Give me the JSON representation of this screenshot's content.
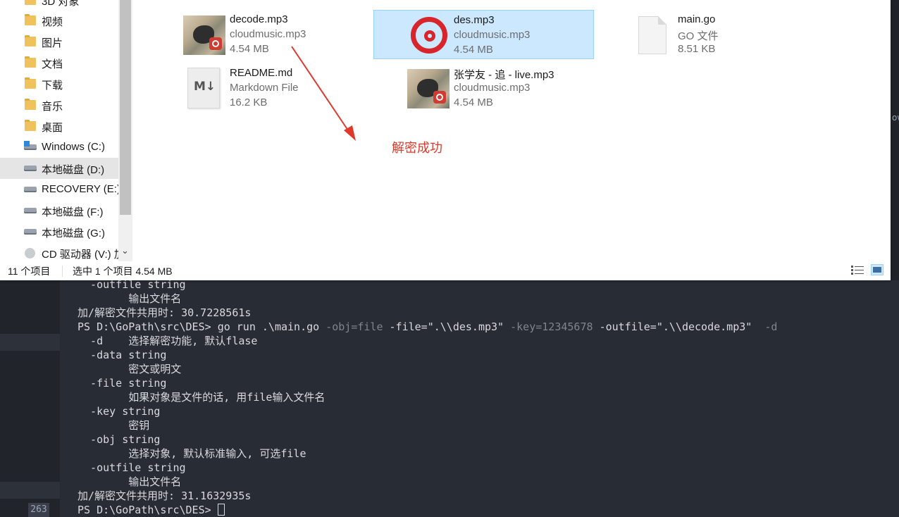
{
  "explorer": {
    "nav": {
      "items": [
        {
          "label": "3D 对象"
        },
        {
          "label": "视频"
        },
        {
          "label": "图片"
        },
        {
          "label": "文档"
        },
        {
          "label": "下载"
        },
        {
          "label": "音乐"
        },
        {
          "label": "桌面"
        },
        {
          "label": "Windows (C:)"
        },
        {
          "label": "本地磁盘 (D:)"
        },
        {
          "label": "RECOVERY (E:)"
        },
        {
          "label": "本地磁盘 (F:)"
        },
        {
          "label": "本地磁盘 (G:)"
        },
        {
          "label": "CD 驱动器 (V:) 加"
        }
      ],
      "selected_index": 8,
      "scroll_chevron": "⌄"
    },
    "files": [
      {
        "name": "decode.mp3",
        "type": "cloudmusic.mp3",
        "size": "4.54 MB",
        "icon": "album-art-icon"
      },
      {
        "name": "des.mp3",
        "type": "cloudmusic.mp3",
        "size": "4.54 MB",
        "icon": "netease-music-icon",
        "selected": true
      },
      {
        "name": "main.go",
        "type": "GO 文件",
        "size": "8.51 KB",
        "icon": "generic-file-icon"
      },
      {
        "name": "README.md",
        "type": "Markdown File",
        "size": "16.2 KB",
        "icon": "markdown-file-icon",
        "icon_text": "M↓"
      },
      {
        "name": "张学友 - 追 - live.mp3",
        "type": "cloudmusic.mp3",
        "size": "4.54 MB",
        "icon": "album-art-icon"
      }
    ],
    "annotation": "解密成功",
    "status": {
      "count": "11 个项目",
      "selected": "选中 1 个项目  4.54 MB"
    },
    "colors": {
      "selection_bg": "#cce8ff",
      "selection_border": "#99d1ff",
      "annotation": "#e0392b"
    }
  },
  "terminal": {
    "line_number": "263",
    "lines": [
      {
        "text": "  -outfile string"
      },
      {
        "text": "        输出文件名"
      },
      {
        "text": "加/解密文件共用时: 30.7228561s"
      },
      {
        "segments": [
          {
            "text": "PS D:\\GoPath\\src\\DES> ",
            "style": "plain"
          },
          {
            "text": "go run .\\main.go ",
            "style": "plain"
          },
          {
            "text": "-obj=file ",
            "style": "dim"
          },
          {
            "text": "-file=\".\\\\des.mp3\" ",
            "style": "plain"
          },
          {
            "text": "-key=12345678 ",
            "style": "dim"
          },
          {
            "text": "-outfile=\".\\\\decode.mp3\"  ",
            "style": "plain"
          },
          {
            "text": "-d",
            "style": "dim"
          }
        ]
      },
      {
        "text": "  -d    选择解密功能, 默认flase"
      },
      {
        "text": "  -data string"
      },
      {
        "text": "        密文或明文"
      },
      {
        "text": "  -file string"
      },
      {
        "text": "        如果对象是文件的话, 用file输入文件名"
      },
      {
        "text": "  -key string"
      },
      {
        "text": "        密钥"
      },
      {
        "text": "  -obj string"
      },
      {
        "text": "        选择对象, 默认标准输入, 可选file"
      },
      {
        "text": "  -outfile string"
      },
      {
        "text": "        输出文件名"
      },
      {
        "text": "加/解密文件共用时: 31.1632935s"
      },
      {
        "text": "PS D:\\GoPath\\src\\DES> ",
        "cursor": true
      }
    ],
    "right_edge_text": "ow",
    "colors": {
      "bg": "#282c34",
      "text": "#d7dae0",
      "dim": "#7f848e"
    }
  }
}
